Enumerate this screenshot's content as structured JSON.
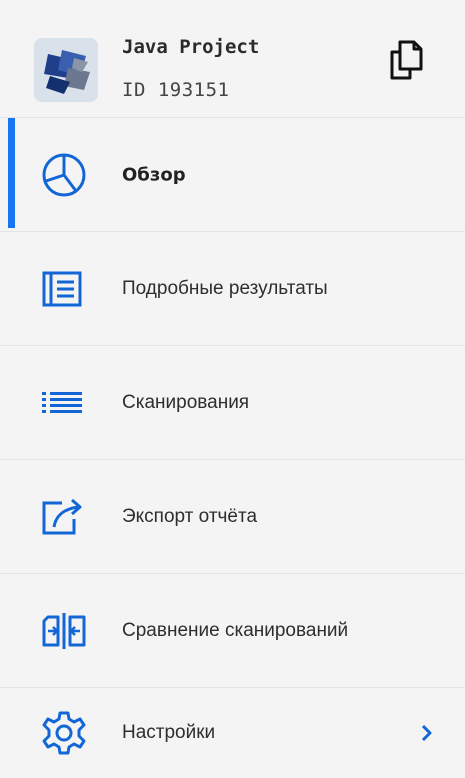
{
  "project": {
    "title": "Java Project",
    "id_label": "ID 193151"
  },
  "nav": {
    "items": [
      {
        "label": "Обзор",
        "icon": "pie-chart-icon",
        "active": true
      },
      {
        "label": "Подробные результаты",
        "icon": "list-box-icon",
        "active": false
      },
      {
        "label": "Сканирования",
        "icon": "bullet-list-icon",
        "active": false
      },
      {
        "label": "Экспорт отчёта",
        "icon": "export-icon",
        "active": false
      },
      {
        "label": "Сравнение сканирований",
        "icon": "compare-icon",
        "active": false
      },
      {
        "label": "Настройки",
        "icon": "gear-icon",
        "active": false,
        "has_submenu": true
      }
    ]
  },
  "colors": {
    "accent": "#1675f0",
    "icon": "#1366d6",
    "background": "#f4f4f4",
    "divider": "#e4e4e4"
  }
}
